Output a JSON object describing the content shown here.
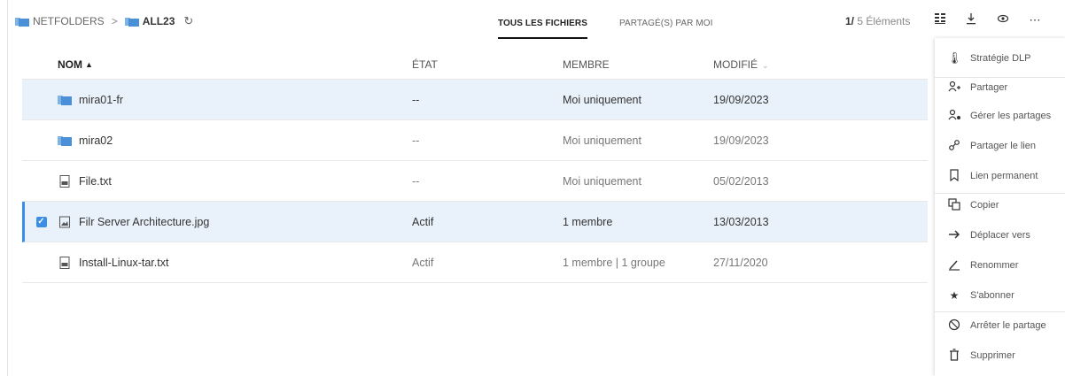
{
  "breadcrumb": {
    "root": "NETFOLDERS",
    "separator": ">",
    "current": "ALL23"
  },
  "tabs": [
    {
      "label": "TOUS LES FICHIERS",
      "active": true
    },
    {
      "label": "PARTAGÉ(S) PAR MOI",
      "active": false
    }
  ],
  "items_count": {
    "selected": "1/",
    "total": "5 Éléments"
  },
  "table": {
    "headers": {
      "name": "NOM",
      "state": "ÉTAT",
      "member": "MEMBRE",
      "modified": "MODIFIÉ"
    },
    "rows": [
      {
        "name": "mira01-fr",
        "type": "folder",
        "state": "--",
        "member": "Moi uniquement",
        "modified": "19/09/2023"
      },
      {
        "name": "mira02",
        "type": "folder",
        "state": "--",
        "member": "Moi uniquement",
        "modified": "19/09/2023"
      },
      {
        "name": "File.txt",
        "type": "txt",
        "state": "--",
        "member": "Moi uniquement",
        "modified": "05/02/2013"
      },
      {
        "name": "Filr Server Architecture.jpg",
        "type": "image",
        "state": "Actif",
        "member": "1 membre",
        "modified": "13/03/2013"
      },
      {
        "name": "Install-Linux-tar.txt",
        "type": "txt",
        "state": "Actif",
        "member": "1 membre | 1 groupe",
        "modified": "27/11/2020"
      }
    ]
  },
  "context_menu": [
    {
      "label": "Stratégie DLP",
      "icon": "thermometer-icon"
    },
    {
      "label": "Partager",
      "icon": "share-user-icon"
    },
    {
      "label": "Gérer les partages",
      "icon": "manage-shares-icon"
    },
    {
      "label": "Partager le lien",
      "icon": "link-icon"
    },
    {
      "label": "Lien permanent",
      "icon": "bookmark-icon"
    },
    {
      "label": "Copier",
      "icon": "copy-icon"
    },
    {
      "label": "Déplacer vers",
      "icon": "arrow-right-icon"
    },
    {
      "label": "Renommer",
      "icon": "pencil-icon"
    },
    {
      "label": "S'abonner",
      "icon": "star-icon"
    },
    {
      "label": "Arrêter le partage",
      "icon": "stop-share-icon"
    },
    {
      "label": "Supprimer",
      "icon": "trash-icon"
    }
  ],
  "colors": {
    "accent": "#3a8ee6",
    "selected_row": "#e9f2fb",
    "folder": "#4a90d9"
  }
}
